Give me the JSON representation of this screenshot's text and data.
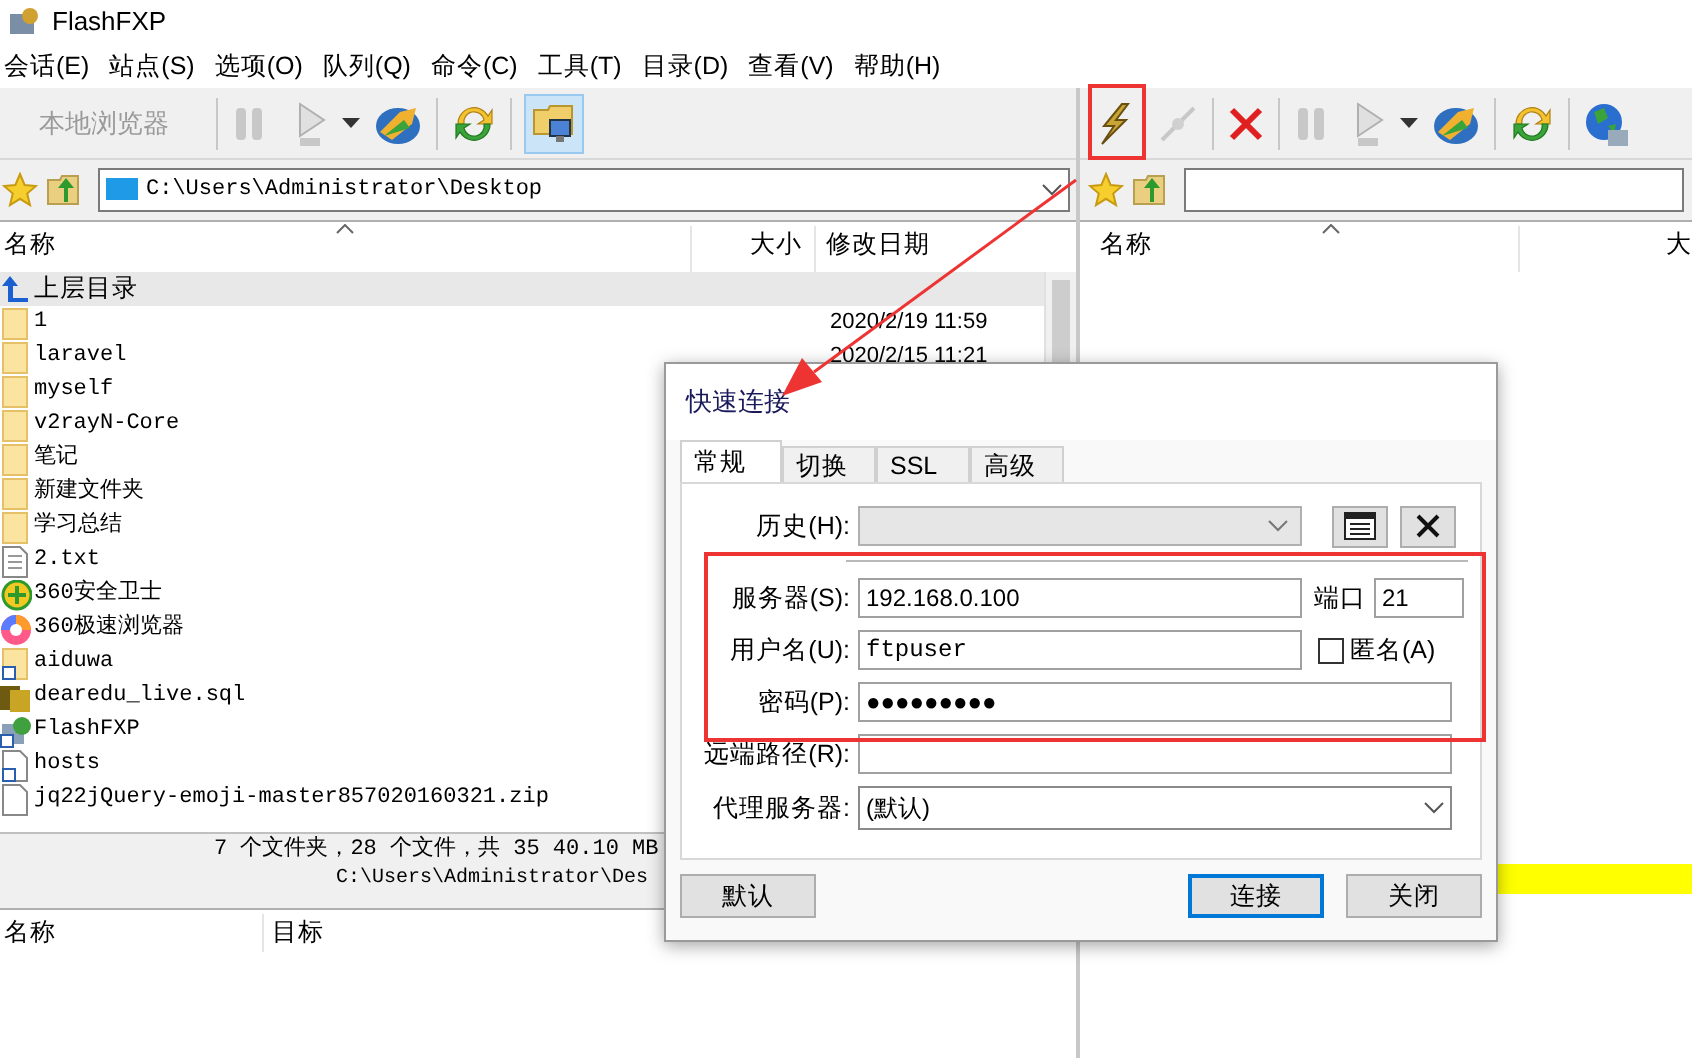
{
  "window": {
    "title": "FlashFXP"
  },
  "menu": [
    {
      "label": "会话(E)"
    },
    {
      "label": "站点(S)"
    },
    {
      "label": "选项(O)"
    },
    {
      "label": "队列(Q)"
    },
    {
      "label": "命令(C)"
    },
    {
      "label": "工具(T)"
    },
    {
      "label": "目录(D)"
    },
    {
      "label": "查看(V)"
    },
    {
      "label": "帮助(H)"
    }
  ],
  "left_pane": {
    "local_browser": {
      "label": "本地浏览器",
      "disabled": true
    },
    "view_toggle": {
      "selected": true
    },
    "path": "C:\\Users\\Administrator\\Desktop",
    "columns": [
      "名称",
      "大小",
      "修改日期"
    ],
    "rows": [
      {
        "name": "上层目录",
        "kind": "up",
        "selected": true
      },
      {
        "name": "1",
        "kind": "folder",
        "modified": "2020/2/19 11:59",
        "selected": false
      },
      {
        "name": "laravel",
        "kind": "folder",
        "modified": "2020/2/15 11:21",
        "selected": false
      },
      {
        "name": "myself",
        "kind": "folder",
        "selected": false
      },
      {
        "name": "v2rayN-Core",
        "kind": "folder",
        "selected": false
      },
      {
        "name": "笔记",
        "kind": "folder",
        "selected": false
      },
      {
        "name": "新建文件夹",
        "kind": "folder",
        "selected": false
      },
      {
        "name": "学习总结",
        "kind": "folder",
        "selected": false
      },
      {
        "name": "2.txt",
        "kind": "text",
        "selected": false
      },
      {
        "name": "360安全卫士",
        "kind": "shield",
        "selected": false
      },
      {
        "name": "360极速浏览器",
        "kind": "browser",
        "selected": false
      },
      {
        "name": "aiduwa",
        "kind": "folder-link",
        "selected": false
      },
      {
        "name": "dearedu_live.sql",
        "kind": "sql",
        "selected": false
      },
      {
        "name": "FlashFXP",
        "kind": "app",
        "selected": false
      },
      {
        "name": "hosts",
        "kind": "file-link",
        "selected": false
      },
      {
        "name": "jq22jQuery-emoji-master857020160321.zip",
        "kind": "file",
        "selected": false
      }
    ],
    "status": "7 个文件夹，28 个文件，共 35 40.10 MB",
    "status_path": "C:\\Users\\Administrator\\Des"
  },
  "queue": {
    "columns": [
      "名称",
      "目标"
    ]
  },
  "right_pane": {
    "columns": [
      "名称",
      "大"
    ]
  },
  "dialog": {
    "title": "快速连接",
    "tabs": [
      {
        "label": "常规",
        "selected": true
      },
      {
        "label": "切换",
        "selected": false
      },
      {
        "label": "SSL",
        "selected": false
      },
      {
        "label": "高级",
        "selected": false
      }
    ],
    "history": {
      "label": "历史(H):",
      "disabled": true
    },
    "server": {
      "label": "服务器(S):",
      "value": "192.168.0.100"
    },
    "port": {
      "label": "端口",
      "value": "21"
    },
    "user": {
      "label": "用户名(U):",
      "value": "ftpuser"
    },
    "anonymous": {
      "label": "匿名(A)",
      "checked": false
    },
    "password": {
      "label": "密码(P):",
      "value": "●●●●●●●●●"
    },
    "remote_path": {
      "label": "远端路径(R):"
    },
    "proxy": {
      "label": "代理服务器:",
      "value": "(默认)"
    },
    "buttons": [
      {
        "label": "默认",
        "focused": false
      },
      {
        "label": "连接",
        "focused": true
      },
      {
        "label": "关闭",
        "focused": false
      }
    ]
  }
}
